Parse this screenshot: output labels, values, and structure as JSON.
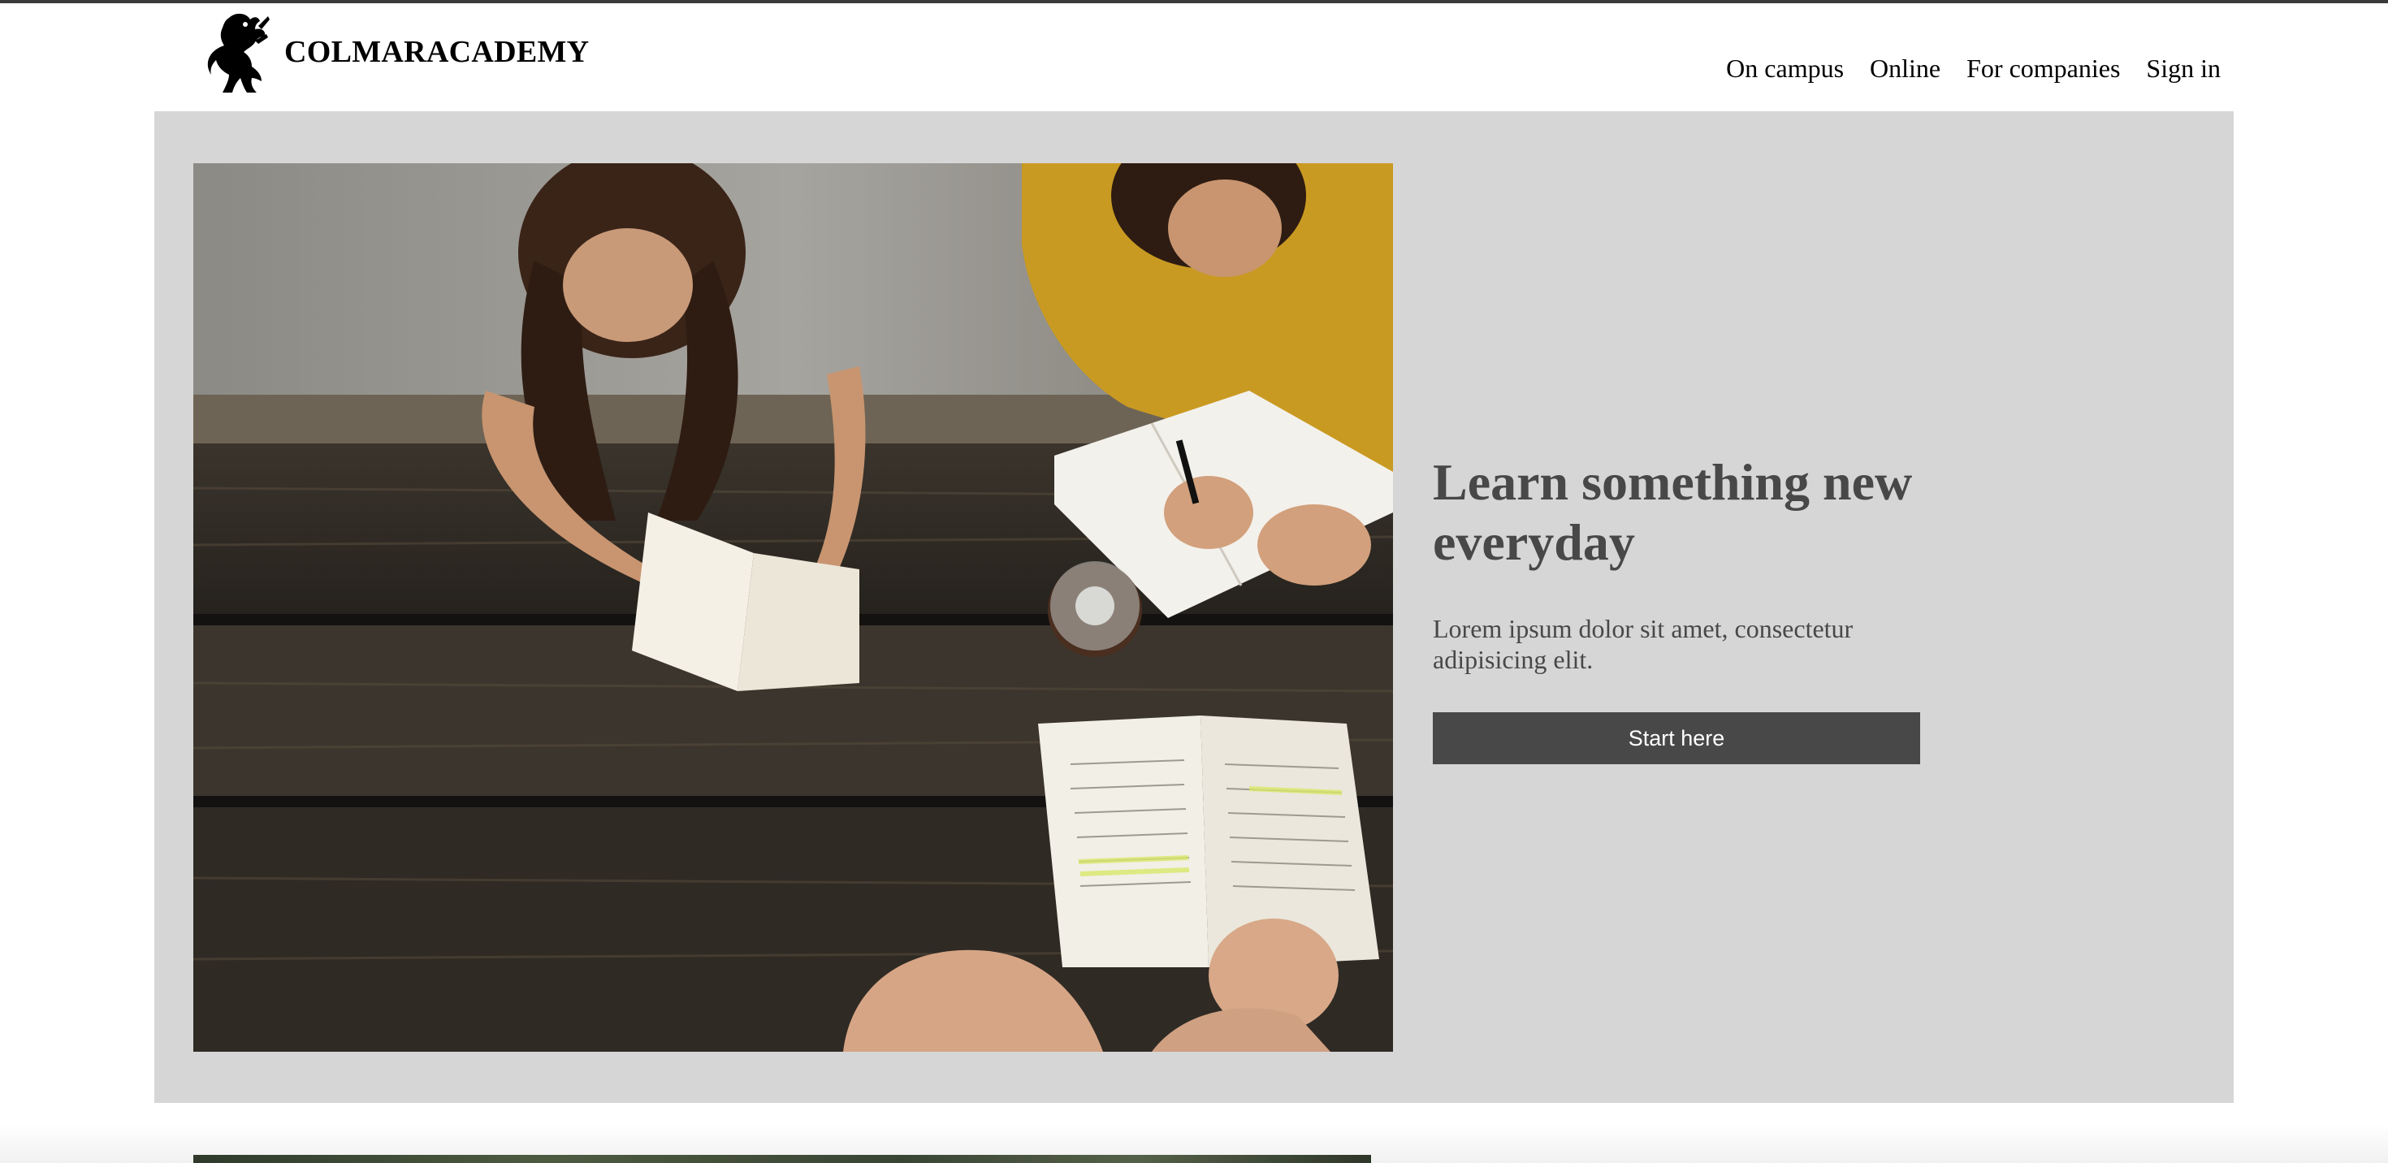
{
  "brand": {
    "name": "COLMARACADEMY",
    "logo_icon": "rampant-lion-icon"
  },
  "nav": {
    "items": [
      {
        "label": "On campus"
      },
      {
        "label": "Online"
      },
      {
        "label": "For companies"
      },
      {
        "label": "Sign in"
      }
    ]
  },
  "hero": {
    "image_icon": "students-studying-photo",
    "title": "Learn something new everyday",
    "text": "Lorem ipsum dolor sit amet, consectetur adipisicing elit.",
    "button_label": "Start here"
  },
  "colors": {
    "hero_background": "#d6d6d6",
    "text_dark": "#484848",
    "button_background": "#484848",
    "button_text": "#ffffff"
  }
}
